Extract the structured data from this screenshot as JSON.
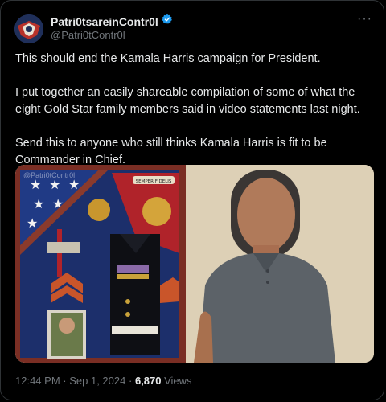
{
  "post": {
    "display_name": "Patri0tsareinContr0l",
    "handle": "@Patri0tContr0l",
    "paragraphs": [
      "This should end the Kamala Harris campaign for President.",
      "I put together an easily shareable compilation of some of what the eight Gold Star family members said in video statements last night.",
      "Send this to anyone who still thinks Kamala Harris is fit to be Commander in Chief."
    ],
    "media_watermark": "@Patri0tContr0l",
    "plaque_text": "SEMPER FIDELIS",
    "time": "12:44 PM",
    "date": "Sep 1, 2024",
    "separator": "·",
    "views_count": "6,870",
    "views_label": "Views"
  },
  "colors": {
    "verified": "#1d9bf0",
    "muted": "#71767b",
    "text": "#e7e9ea"
  },
  "icons": {
    "verified": "verified-badge-icon",
    "more": "more-options-icon"
  }
}
